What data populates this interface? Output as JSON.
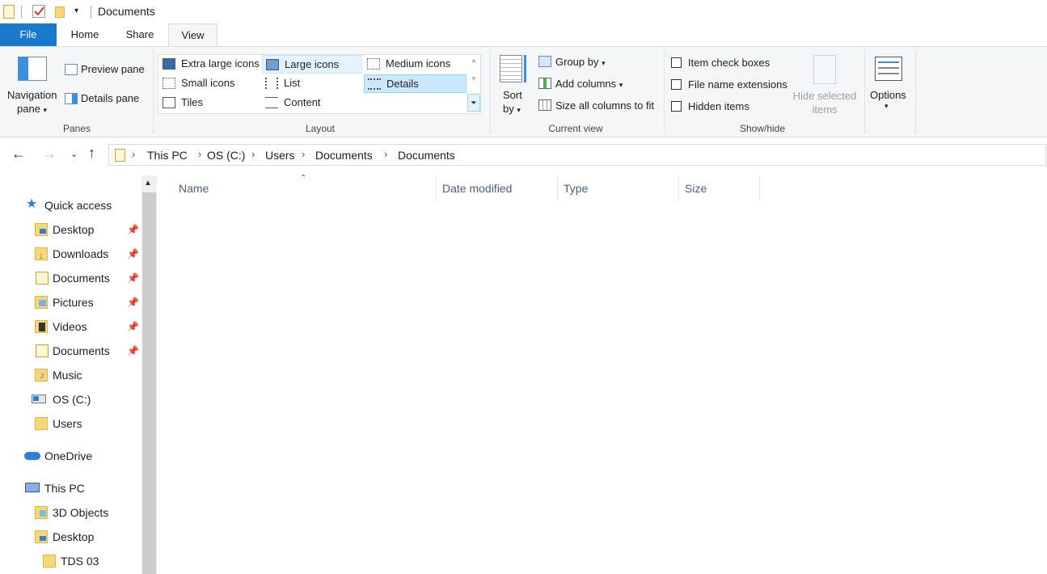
{
  "window": {
    "title": "Documents"
  },
  "tabs": [
    {
      "label": "File"
    },
    {
      "label": "Home"
    },
    {
      "label": "Share"
    },
    {
      "label": "View"
    }
  ],
  "ribbon": {
    "panes": {
      "navigation_pane_line1": "Navigation",
      "navigation_pane_line2": "pane",
      "preview_pane": "Preview pane",
      "details_pane": "Details pane",
      "group": "Panes"
    },
    "layout": {
      "items": [
        "Extra large icons",
        "Large icons",
        "Medium icons",
        "Small icons",
        "List",
        "Details",
        "Tiles",
        "Content"
      ],
      "selected": "Details",
      "group": "Layout"
    },
    "current_view": {
      "sort_line1": "Sort",
      "sort_line2": "by",
      "group_by": "Group by",
      "add_columns": "Add columns",
      "size_all": "Size all columns to fit",
      "group": "Current view"
    },
    "show_hide": {
      "item_check_boxes": "Item check boxes",
      "file_name_extensions": "File name extensions",
      "hidden_items": "Hidden items",
      "hide_selected_line1": "Hide selected",
      "hide_selected_line2": "items",
      "group": "Show/hide"
    },
    "options": {
      "label": "Options"
    }
  },
  "address": {
    "crumbs": [
      "This PC",
      "OS (C:)",
      "Users",
      "Documents",
      "Documents"
    ]
  },
  "nav": {
    "quick_access": "Quick access",
    "items": [
      {
        "label": "Desktop",
        "icon": "desktop-folder-icon",
        "pinned": true
      },
      {
        "label": "Downloads",
        "icon": "downloads-folder-icon",
        "pinned": true
      },
      {
        "label": "Documents",
        "icon": "documents-folder-icon",
        "pinned": true
      },
      {
        "label": "Pictures",
        "icon": "pictures-folder-icon",
        "pinned": true
      },
      {
        "label": "Videos",
        "icon": "videos-folder-icon",
        "pinned": true
      },
      {
        "label": "Documents",
        "icon": "documents-folder-icon",
        "pinned": true
      },
      {
        "label": "Music",
        "icon": "music-folder-icon",
        "pinned": false
      },
      {
        "label": "OS (C:)",
        "icon": "drive-icon",
        "pinned": false
      },
      {
        "label": "Users",
        "icon": "folder-icon",
        "pinned": false
      }
    ],
    "onedrive": "OneDrive",
    "this_pc": "This PC",
    "pc_items": [
      {
        "label": "3D Objects",
        "icon": "3d-objects-folder-icon"
      },
      {
        "label": "Desktop",
        "icon": "desktop-folder-icon"
      },
      {
        "label": "TDS 03",
        "icon": "folder-icon"
      }
    ]
  },
  "columns": [
    {
      "label": "Name"
    },
    {
      "label": "Date modified"
    },
    {
      "label": "Type"
    },
    {
      "label": "Size"
    }
  ],
  "colors": {
    "file_tab": "#1979ca",
    "selection": "#cce8ff",
    "folder": "#f8d775"
  }
}
